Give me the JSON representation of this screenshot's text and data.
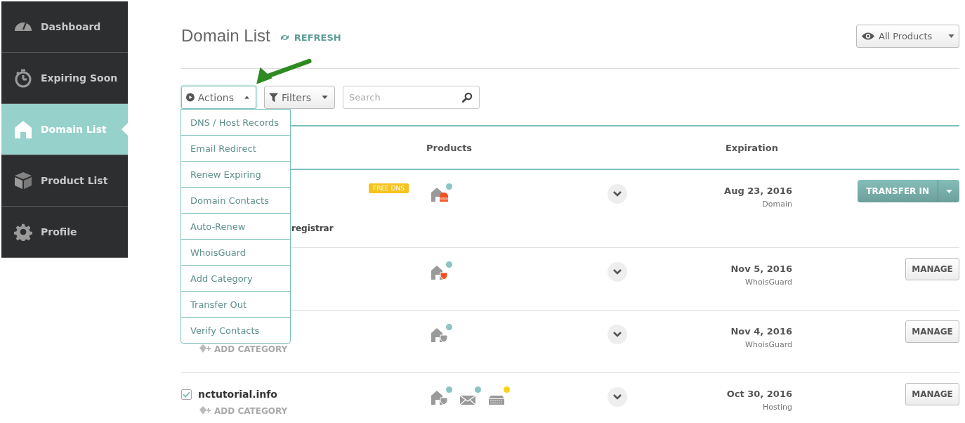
{
  "sidebar": {
    "items": [
      {
        "label": "Dashboard",
        "selected": false
      },
      {
        "label": "Expiring Soon",
        "selected": false
      },
      {
        "label": "Domain List",
        "selected": true
      },
      {
        "label": "Product List",
        "selected": false
      },
      {
        "label": "Profile",
        "selected": false
      }
    ]
  },
  "header": {
    "title": "Domain List",
    "refresh": "REFRESH",
    "view_filter": "All Products"
  },
  "toolbar": {
    "actions": {
      "label": "Actions",
      "expanded": true
    },
    "filters": {
      "label": "Filters"
    },
    "search": {
      "placeholder": "Search"
    }
  },
  "actions_menu": [
    "DNS / Host Records",
    "Email Redirect",
    "Renew Expiring",
    "Domain Contacts",
    "Auto-Renew",
    "WhoisGuard",
    "Add Category",
    "Transfer Out",
    "Verify Contacts"
  ],
  "table": {
    "columns": [
      "Products",
      "Expiration"
    ],
    "rows": [
      {
        "badge": "FREE DNS",
        "note": "registrar",
        "products": [
          {
            "kind": "domain-dns",
            "color": "#8cc4c4"
          }
        ],
        "expiration": "Aug 23, 2016",
        "type": "Domain",
        "action": {
          "kind": "split",
          "label": "TRANSFER IN"
        }
      },
      {
        "products": [
          {
            "kind": "domain-shield-alert",
            "color": "#8cc4c4"
          }
        ],
        "expiration": "Nov 5, 2016",
        "type": "WhoisGuard",
        "action": {
          "kind": "plain",
          "label": "MANAGE"
        }
      },
      {
        "add_category": "ADD CATEGORY",
        "products": [
          {
            "kind": "domain-shield",
            "color": "#8cc4c4"
          }
        ],
        "expiration": "Nov 4, 2016",
        "type": "WhoisGuard",
        "action": {
          "kind": "plain",
          "label": "MANAGE"
        }
      },
      {
        "checked": true,
        "name": "nctutorial.info",
        "add_category": "ADD CATEGORY",
        "products": [
          {
            "kind": "domain-shield",
            "color": "#8cc4c4"
          },
          {
            "kind": "email",
            "color": "#8cc4c4"
          },
          {
            "kind": "hosting",
            "color": "#f7d417"
          }
        ],
        "expiration": "Oct 30, 2016",
        "type": "Hosting",
        "action": {
          "kind": "plain",
          "label": "MANAGE"
        }
      }
    ]
  }
}
